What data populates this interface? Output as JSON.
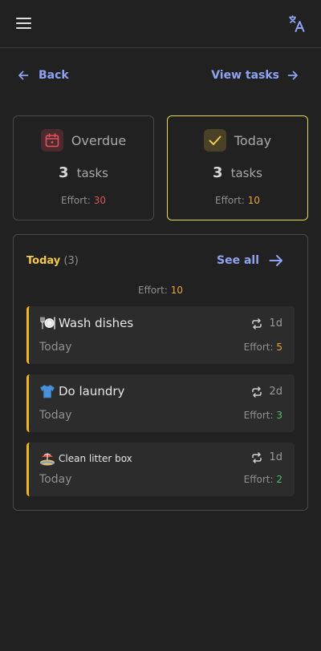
{
  "header": {
    "menu_icon": "hamburger-icon",
    "translate_icon": "translate-icon",
    "accent": "#8fa3f3"
  },
  "nav": {
    "back_label": "Back",
    "view_tasks_label": "View tasks"
  },
  "summary": [
    {
      "title": "Overdue",
      "count": "3",
      "unit": "tasks",
      "effort_label": "Effort:",
      "effort_value": "30",
      "icon": "calendar-icon"
    },
    {
      "title": "Today",
      "count": "3",
      "unit": "tasks",
      "effort_label": "Effort:",
      "effort_value": "10",
      "icon": "check-icon"
    }
  ],
  "today_panel": {
    "title": "Today",
    "count": "(3)",
    "see_all_label": "See all",
    "effort_label": "Effort:",
    "effort_value": "10",
    "tasks": [
      {
        "emoji": "plate-icon",
        "name": "Wash dishes",
        "repeat": "1d",
        "date": "Today",
        "effort_label": "Effort:",
        "effort_value": "5"
      },
      {
        "emoji": "shirt-icon",
        "name": "Do laundry",
        "repeat": "2d",
        "date": "Today",
        "effort_label": "Effort:",
        "effort_value": "3"
      },
      {
        "emoji": "sand-icon",
        "name": "Clean litter box",
        "repeat": "1d",
        "date": "Today",
        "effort_label": "Effort:",
        "effort_value": "2"
      }
    ]
  },
  "colors": {
    "background": "#212121",
    "today_border": "#e8d84a",
    "task_bar": "#f2b51b",
    "effort_red": "#e0525a",
    "effort_amber": "#e9a33a",
    "effort_green": "#4ec06a"
  }
}
